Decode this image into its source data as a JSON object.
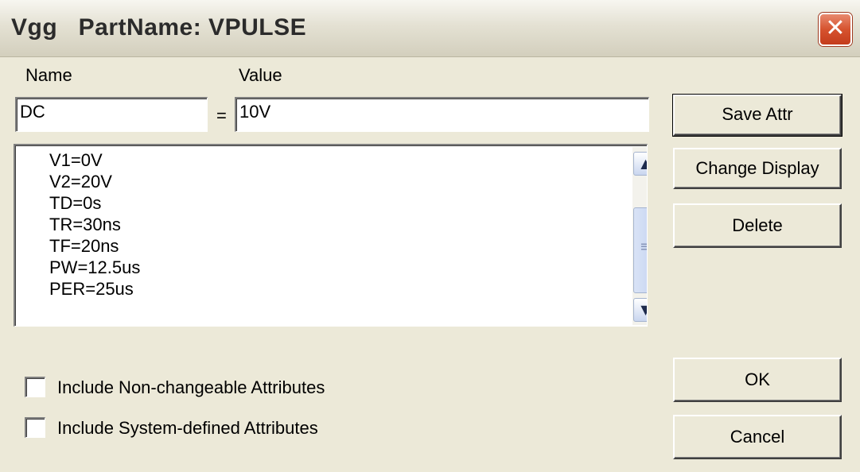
{
  "window": {
    "title": "Vgg   PartName: VPULSE",
    "close_glyph": "✕"
  },
  "editor": {
    "name_label": "Name",
    "value_label": "Value",
    "name_value": "DC",
    "equals": "=",
    "value_value": "10V"
  },
  "attributes": {
    "items": [
      "V1=0V",
      "V2=20V",
      "TD=0s",
      "TR=30ns",
      "TF=20ns",
      "PW=12.5us",
      "PER=25us"
    ]
  },
  "scrollbar": {
    "up_icon": "up-arrow-icon",
    "down_icon": "down-arrow-icon",
    "grip_icon": "grip-icon",
    "up_glyph": "▲",
    "down_glyph": "▼",
    "grip_glyph": "≡"
  },
  "buttons": {
    "save_attr": "Save Attr",
    "change_display": "Change Display",
    "delete": "Delete",
    "ok": "OK",
    "cancel": "Cancel"
  },
  "options": {
    "non_changeable": {
      "label": "Include Non-changeable Attributes",
      "checked": false
    },
    "system_defined": {
      "label": "Include System-defined Attributes",
      "checked": false
    }
  },
  "colors": {
    "dialog_bg": "#ece9d8",
    "close_button": "#d6532f",
    "scrollbar_accent": "#c3d2f0"
  }
}
